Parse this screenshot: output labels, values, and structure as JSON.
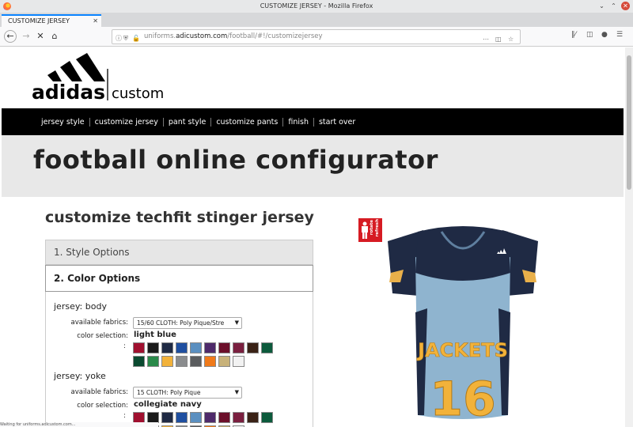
{
  "window": {
    "title": "CUSTOMIZE JERSEY - Mozilla Firefox"
  },
  "tab": {
    "label": "CUSTOMIZE JERSEY"
  },
  "url": {
    "domain": "uniforms.adicustom.com",
    "prefix": "uniforms.",
    "host": "adicustom.com",
    "path": "/football/#!/customizejersey"
  },
  "brand": {
    "name": "adidas",
    "suffix": "custom"
  },
  "topnav": [
    "jersey style",
    "customize jersey",
    "pant style",
    "customize pants",
    "finish",
    "start over"
  ],
  "hero": {
    "title": "football online configurator"
  },
  "page": {
    "subtitle": "customize techfit stinger jersey"
  },
  "accordion": {
    "style_options": "1. Style Options",
    "color_options": "2. Color Options"
  },
  "body_section": {
    "title": "jersey: body",
    "fabrics_label": "available fabrics:",
    "fabric_value": "15/60 CLOTH: Poly Pique/Stre",
    "color_label": "color selection:",
    "color_value": "light blue"
  },
  "yoke_section": {
    "title": "jersey: yoke",
    "fabrics_label": "available fabrics:",
    "fabric_value": "15 CLOTH: Poly Pique",
    "color_label": "color selection:",
    "color_value": "collegiate navy"
  },
  "swatch_colors": [
    "#a0102f",
    "#1a1a1a",
    "#1f2a44",
    "#1f4fa0",
    "#5a8fc0",
    "#4e2a6a",
    "#6b0f2a",
    "#7a1f3f",
    "#3a2216",
    "#0c5a3c",
    "#0a4a30",
    "#2a8a4a",
    "#f2b23a",
    "#8a8c8e",
    "#5a5c5e",
    "#f07a1a",
    "#c8b27a",
    "#f2f2f2"
  ],
  "yoke_swatch_colors": [
    "#a0102f",
    "#1a1a1a",
    "#1f2a44",
    "#1f4fa0",
    "#5a8fc0",
    "#4e2a6a",
    "#6b0f2a",
    "#7a1f3f",
    "#3a2216",
    "#0c5a3c"
  ],
  "yoke_row2_colors": [
    "#0a4a30",
    "#2a8a4a",
    "#f2b23a",
    "#8a8c8e",
    "#5a5c5e",
    "#f07a1a",
    "#c8b27a",
    "#f2f2f2"
  ],
  "rotate": {
    "line1": "rotate",
    "line2": "refresh"
  },
  "jersey_text": {
    "team": "JACKETS",
    "number": "16"
  },
  "status": {
    "text": "Waiting for uniforms.adicustom.com..."
  }
}
